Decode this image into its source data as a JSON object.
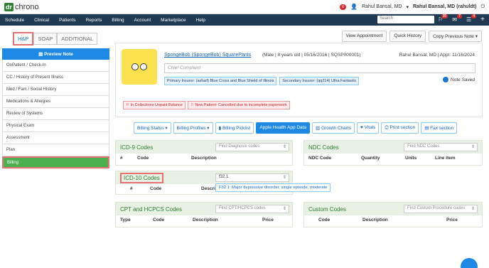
{
  "header": {
    "logo_box": "dr",
    "logo_text": "chrono",
    "notif_count": "6",
    "user_menu": "Rahul Bansal, MD",
    "user_name": "Rahul Bansal, MD (rahuldt)"
  },
  "nav": {
    "items": [
      "Schedule",
      "Clinical",
      "Patients",
      "Reports",
      "Billing",
      "Account",
      "Marketplace",
      "Help"
    ],
    "search_placeholder": "Search",
    "badges": [
      "30",
      "7",
      "4"
    ]
  },
  "tabs": [
    "H&P",
    "SOAP",
    "ADDITIONAL"
  ],
  "sidebar": {
    "preview": "Preview Note",
    "items": [
      "OnPatient / Check-In",
      "CC / History of Present Illness",
      "Med / Fam / Social History",
      "Medications & Allergies",
      "Review of Systems",
      "Physical Exam",
      "Assessment",
      "Plan",
      "Billing"
    ]
  },
  "actions": [
    "View Appointment",
    "Quick History",
    "Copy Previous Note"
  ],
  "patient": {
    "name": "SpongeBob (SpongeBob) SquarePants",
    "meta": "(Male | 8 years old | 05/16/2016 | SQSP000001)",
    "provider": "Rahul Bansal, MD | Appt: 11/16/2024",
    "cc_placeholder": "Chief Complaint",
    "primary_ins": "Primary Insurer: (asfasf) Blue Cross and Blue Shield of Illinois",
    "secondary_ins": "Secondary Insurer: (qq214) Ultra Fantastic",
    "note_saved": "Note Saved",
    "alerts": [
      "In Collections Unpaid Balance",
      "New Patient: Cancelled due to incomplete paperwork"
    ]
  },
  "billing_tools": [
    "Billing Status",
    "Billing Profiles",
    "Billing Picklist",
    "Apple Health App Data",
    "Growth Charts",
    "Vitals",
    "Print section",
    "Fax section"
  ],
  "icd9": {
    "title": "ICD-9 Codes",
    "search": "Find Diagnosis codes",
    "cols": [
      "#",
      "Code",
      "Description"
    ]
  },
  "ndc": {
    "title": "NDC Codes",
    "search": "Find NDC Codes",
    "cols": [
      "NDC Code",
      "Quantity",
      "Units",
      "Line Item"
    ]
  },
  "icd10": {
    "title": "ICD-10 Codes",
    "search_value": "f32.1",
    "cols": [
      "#",
      "Code",
      "Description"
    ],
    "suggestion": "F32.1: Major depressive disorder, single episode, moderate"
  },
  "cpt": {
    "title": "CPT and HCPCS Codes",
    "search": "Find CPT/HCPCS codes",
    "cols": [
      "Type",
      "Code",
      "Description",
      "Price"
    ]
  },
  "custom": {
    "title": "Custom Codes",
    "search": "Find Custom Procedure codes",
    "cols": [
      "Code",
      "Description",
      "Price"
    ]
  },
  "colors": {
    "nav": "#1f3a52",
    "accent_green": "#4caf50",
    "accent_blue": "#1e88e5",
    "highlight_red": "#e57373"
  }
}
